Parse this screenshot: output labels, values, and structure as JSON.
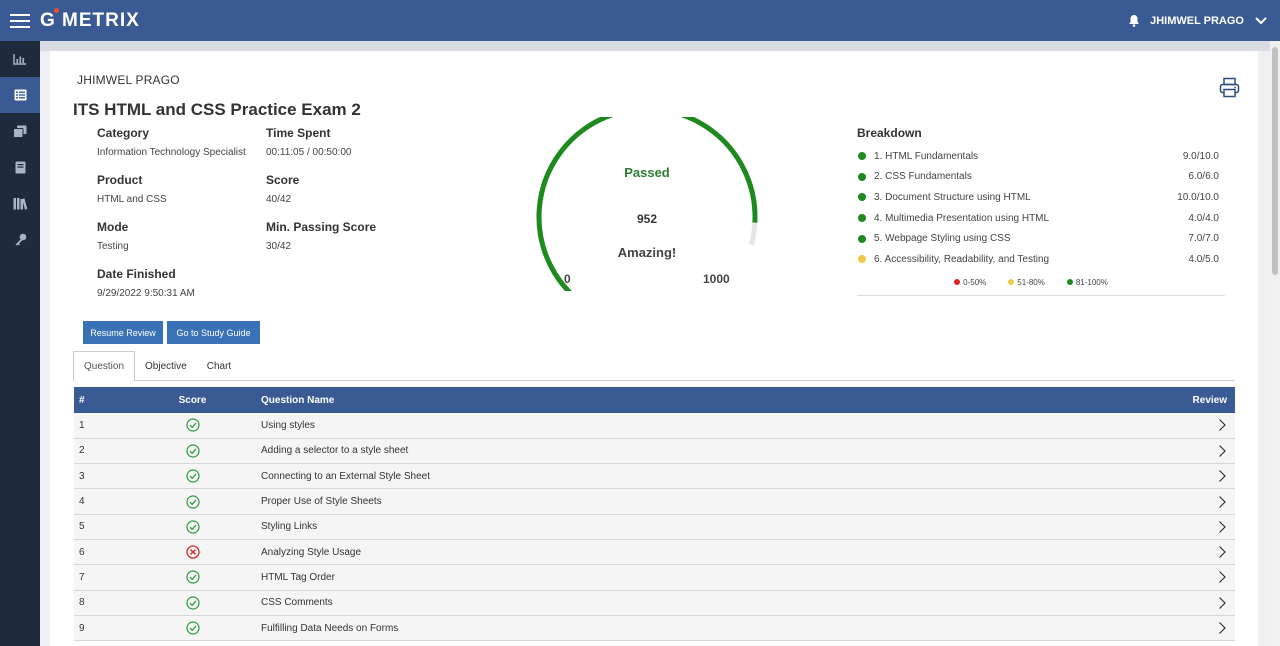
{
  "app": {
    "logo": "G METRIX",
    "user_menu": "JHIMWEL PRAGO"
  },
  "sidebar": {
    "items": [
      {
        "icon": "bar-chart-icon",
        "active": false
      },
      {
        "icon": "list-icon",
        "active": true
      },
      {
        "icon": "copy-icon",
        "active": false
      },
      {
        "icon": "book-icon",
        "active": false
      },
      {
        "icon": "library-icon",
        "active": false
      },
      {
        "icon": "key-icon",
        "active": false
      }
    ]
  },
  "report": {
    "user_name": "JHIMWEL PRAGO",
    "title": "ITS HTML and CSS Practice Exam 2",
    "category_label": "Category",
    "category": "Information Technology Specialist",
    "time_label": "Time Spent",
    "time": "00:11:05 / 00:50:00",
    "product_label": "Product",
    "product": "HTML and CSS",
    "score_label": "Score",
    "score": "40/42",
    "mode_label": "Mode",
    "mode": "Testing",
    "min_label": "Min. Passing Score",
    "min_score": "30/42",
    "date_label": "Date Finished",
    "date": "9/29/2022 9:50:31 AM"
  },
  "gauge": {
    "status": "Passed",
    "value": "952",
    "message": "Amazing!",
    "min": "0",
    "max": "1000",
    "fraction": 0.952
  },
  "breakdown": {
    "title": "Breakdown",
    "items": [
      {
        "name": "1. HTML Fundamentals",
        "score": "9.0/10.0",
        "color": "#1e8a1e"
      },
      {
        "name": "2. CSS Fundamentals",
        "score": "6.0/6.0",
        "color": "#1e8a1e"
      },
      {
        "name": "3. Document Structure using HTML",
        "score": "10.0/10.0",
        "color": "#1e8a1e"
      },
      {
        "name": "4. Multimedia Presentation using HTML",
        "score": "4.0/4.0",
        "color": "#1e8a1e"
      },
      {
        "name": "5. Webpage Styling using CSS",
        "score": "7.0/7.0",
        "color": "#1e8a1e"
      },
      {
        "name": "6. Accessibility, Readability, and Testing",
        "score": "4.0/5.0",
        "color": "#f0c94a"
      }
    ],
    "legend": [
      {
        "label": "0-50%",
        "color": "#e02424"
      },
      {
        "label": "51-80%",
        "color": "#f0c94a"
      },
      {
        "label": "81-100%",
        "color": "#1e8a1e"
      }
    ]
  },
  "buttons": {
    "resume": "Resume Review",
    "study": "Go to Study Guide"
  },
  "tabs": [
    "Question",
    "Objective",
    "Chart"
  ],
  "table": {
    "headers": {
      "num": "#",
      "score": "Score",
      "name": "Question Name",
      "review": "Review"
    },
    "rows": [
      {
        "num": "1",
        "name": "Using styles",
        "correct": true
      },
      {
        "num": "2",
        "name": "Adding a selector to a style sheet",
        "correct": true
      },
      {
        "num": "3",
        "name": "Connecting to an External Style Sheet",
        "correct": true
      },
      {
        "num": "4",
        "name": "Proper Use of Style Sheets",
        "correct": true
      },
      {
        "num": "5",
        "name": "Styling Links",
        "correct": true
      },
      {
        "num": "6",
        "name": "Analyzing Style Usage",
        "correct": false
      },
      {
        "num": "7",
        "name": "HTML Tag Order",
        "correct": true
      },
      {
        "num": "8",
        "name": "CSS Comments",
        "correct": true
      },
      {
        "num": "9",
        "name": "Fulfilling Data Needs on Forms",
        "correct": true
      }
    ]
  },
  "colors": {
    "header_blue": "#3a5a94",
    "button_blue": "#3a72b8",
    "pass_green": "#1e8a1e",
    "fail_red": "#e02424"
  }
}
